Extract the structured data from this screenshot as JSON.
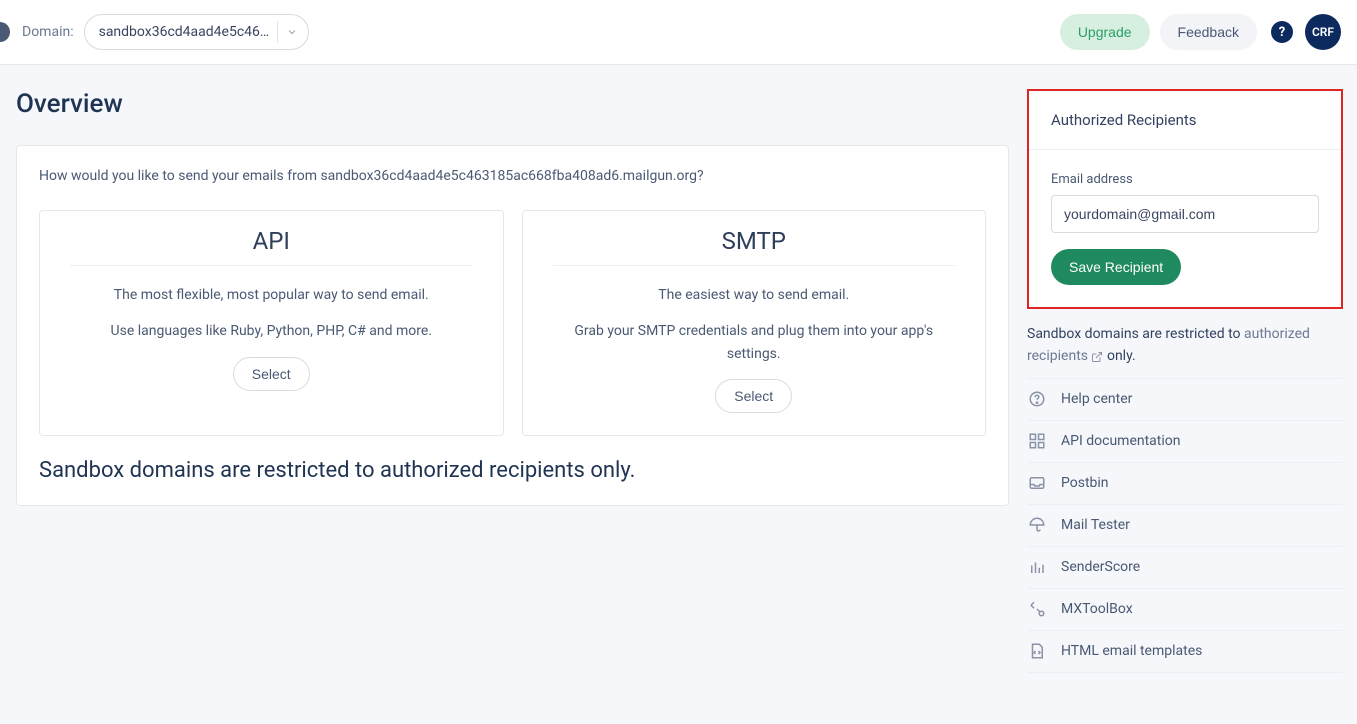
{
  "header": {
    "domain_label": "Domain:",
    "domain_value": "sandbox36cd4aad4e5c46…",
    "upgrade_label": "Upgrade",
    "feedback_label": "Feedback",
    "help_glyph": "?",
    "avatar_initials": "CRF"
  },
  "page_title": "Overview",
  "main": {
    "question": "How would you like to send your emails from sandbox36cd4aad4e5c463185ac668fba408ad6.mailgun.org?",
    "cards": [
      {
        "title": "API",
        "line1": "The most flexible, most popular way to send email.",
        "line2": "Use languages like Ruby, Python, PHP, C# and more.",
        "button": "Select"
      },
      {
        "title": "SMTP",
        "line1": "The easiest way to send email.",
        "line2": "Grab your SMTP credentials and plug them into your app's settings.",
        "button": "Select"
      }
    ],
    "restrict_note": "Sandbox domains are restricted to authorized recipients only."
  },
  "side": {
    "auth_title": "Authorized Recipients",
    "field_label": "Email address",
    "field_value": "yourdomain@gmail.com",
    "save_label": "Save Recipient",
    "note_pre": "Sandbox domains are restricted to ",
    "note_link": "authorized recipients",
    "note_post": " only.",
    "resources": [
      {
        "label": "Help center"
      },
      {
        "label": "API documentation"
      },
      {
        "label": "Postbin"
      },
      {
        "label": "Mail Tester"
      },
      {
        "label": "SenderScore"
      },
      {
        "label": "MXToolBox"
      },
      {
        "label": "HTML email templates"
      }
    ]
  }
}
